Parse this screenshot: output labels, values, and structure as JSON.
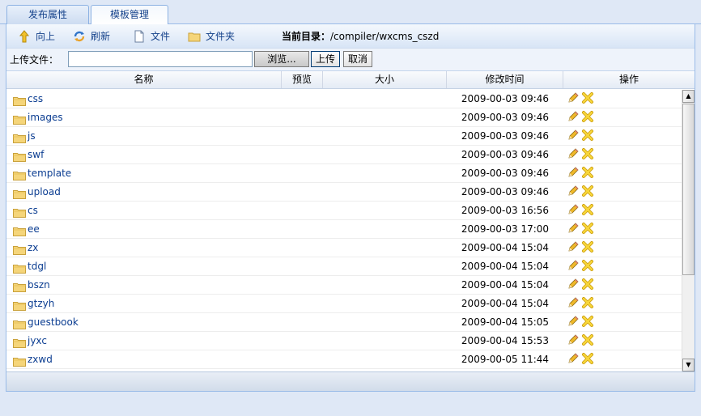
{
  "tabs": [
    {
      "label": "发布属性"
    },
    {
      "label": "模板管理"
    }
  ],
  "toolbar": {
    "up_label": "向上",
    "refresh_label": "刷新",
    "file_label": "文件",
    "folder_label": "文件夹",
    "current_dir_label": "当前目录：",
    "current_dir_value": "/compiler/wxcms_cszd"
  },
  "upload": {
    "label": "上传文件：",
    "file_value": "",
    "browse_label": "浏览...",
    "upload_label": "上传",
    "cancel_label": "取消"
  },
  "columns": {
    "name": "名称",
    "preview": "预览",
    "size": "大小",
    "modified": "修改时间",
    "actions": "操作"
  },
  "rows": [
    {
      "name": "css",
      "time": "2009-00-03 09:46"
    },
    {
      "name": "images",
      "time": "2009-00-03 09:46"
    },
    {
      "name": "js",
      "time": "2009-00-03 09:46"
    },
    {
      "name": "swf",
      "time": "2009-00-03 09:46"
    },
    {
      "name": "template",
      "time": "2009-00-03 09:46"
    },
    {
      "name": "upload",
      "time": "2009-00-03 09:46"
    },
    {
      "name": "cs",
      "time": "2009-00-03 16:56"
    },
    {
      "name": "ee",
      "time": "2009-00-03 17:00"
    },
    {
      "name": "zx",
      "time": "2009-00-04 15:04"
    },
    {
      "name": "tdgl",
      "time": "2009-00-04 15:04"
    },
    {
      "name": "bszn",
      "time": "2009-00-04 15:04"
    },
    {
      "name": "gtzyh",
      "time": "2009-00-04 15:04"
    },
    {
      "name": "guestbook",
      "time": "2009-00-04 15:05"
    },
    {
      "name": "jyxc",
      "time": "2009-00-04 15:53"
    },
    {
      "name": "zxwd",
      "time": "2009-00-05 11:44"
    }
  ],
  "icons": {
    "up": "up-arrow-icon",
    "refresh": "refresh-icon",
    "file": "file-icon",
    "folder": "folder-icon",
    "edit": "pencil-icon",
    "delete": "delete-x-icon"
  },
  "colors": {
    "accent": "#15428b",
    "border": "#99bbe8",
    "folder": "#f5d57a",
    "delete": "#f2c91c"
  }
}
